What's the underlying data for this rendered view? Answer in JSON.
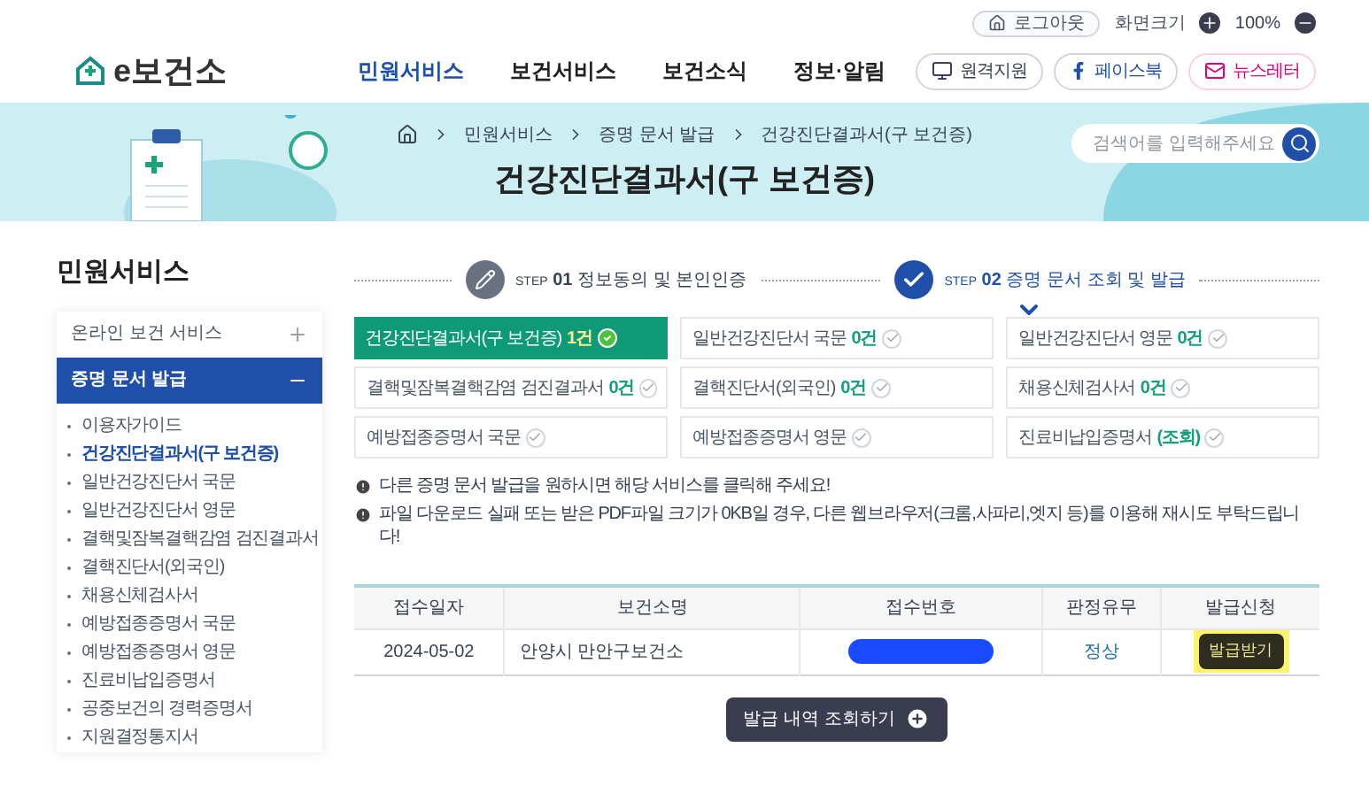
{
  "utility_bar": {
    "logout": "로그아웃",
    "zoom_label": "화면크기",
    "zoom_value": "100%"
  },
  "header": {
    "logo": "e보건소",
    "nav": [
      {
        "label": "민원서비스",
        "selected": true
      },
      {
        "label": "보건서비스",
        "selected": false
      },
      {
        "label": "보건소식",
        "selected": false
      },
      {
        "label": "정보·알림",
        "selected": false
      }
    ],
    "buttons": [
      {
        "kind": "remote",
        "label": "원격지원"
      },
      {
        "kind": "facebook",
        "label": "페이스북"
      },
      {
        "kind": "newsletter",
        "label": "뉴스레터"
      }
    ]
  },
  "banner": {
    "breadcrumb": [
      "민원서비스",
      "증명 문서 발급",
      "건강진단결과서(구 보건증)"
    ],
    "title": "건강진단결과서(구 보건증)",
    "search": {
      "placeholder": "검색어를 입력해주세요"
    }
  },
  "sidebar": {
    "title": "민원서비스",
    "groups": [
      {
        "label": "온라인 보건 서비스",
        "expanded": false
      },
      {
        "label": "증명 문서 발급",
        "expanded": true,
        "children": [
          {
            "label": "이용자가이드",
            "selected": false
          },
          {
            "label": "건강진단결과서(구 보건증)",
            "selected": true
          },
          {
            "label": "일반건강진단서 국문",
            "selected": false
          },
          {
            "label": "일반건강진단서 영문",
            "selected": false
          },
          {
            "label": "결핵및잠복결핵감염 검진결과서",
            "selected": false
          },
          {
            "label": "결핵진단서(외국인)",
            "selected": false
          },
          {
            "label": "채용신체검사서",
            "selected": false
          },
          {
            "label": "예방접종증명서 국문",
            "selected": false
          },
          {
            "label": "예방접종증명서 영문",
            "selected": false
          },
          {
            "label": "진료비납입증명서",
            "selected": false
          },
          {
            "label": "공중보건의 경력증명서",
            "selected": false
          },
          {
            "label": "지원결정통지서",
            "selected": false
          }
        ]
      }
    ]
  },
  "steps": [
    {
      "step": "STEP",
      "number": "01",
      "label": "정보동의 및 본인인증",
      "selected": false
    },
    {
      "step": "STEP",
      "number": "02",
      "label": "증명 문서 조회 및 발급",
      "selected": true
    }
  ],
  "documents": [
    {
      "label": "건강진단결과서(구 보건증)",
      "count": "1건",
      "selected": true
    },
    {
      "label": "일반건강진단서 국문",
      "count": "0건",
      "selected": false
    },
    {
      "label": "일반건강진단서 영문",
      "count": "0건",
      "selected": false
    },
    {
      "label": "결핵및잠복결핵감염 검진결과서",
      "count": "0건",
      "selected": false
    },
    {
      "label": "결핵진단서(외국인)",
      "count": "0건",
      "selected": false
    },
    {
      "label": "채용신체검사서",
      "count": "0건",
      "selected": false
    },
    {
      "label": "예방접종증명서 국문",
      "selected": false
    },
    {
      "label": "예방접종증명서 영문",
      "selected": false
    },
    {
      "label": "진료비납입증명서",
      "count": "(조회)",
      "selected": false
    }
  ],
  "notes": [
    "다른 증명 문서 발급을 원하시면 해당 서비스를 클릭해 주세요!",
    "파일 다운로드 실패 또는 받은 PDF파일 크기가 0KB일 경우, 다른 웹브라우저(크롬,사파리,엣지 등)를 이용해 재시도 부탁드립니다!"
  ],
  "table": {
    "columns": [
      "접수일자",
      "보건소명",
      "접수번호",
      "판정유무",
      "발급신청"
    ],
    "rows": [
      {
        "date": "2024-05-02",
        "center": "안양시 만안구보건소",
        "number_redacted": true,
        "result": "정상",
        "action": "발급받기",
        "highlighted": true
      }
    ]
  },
  "history_button": "발급 내역 조회하기"
}
